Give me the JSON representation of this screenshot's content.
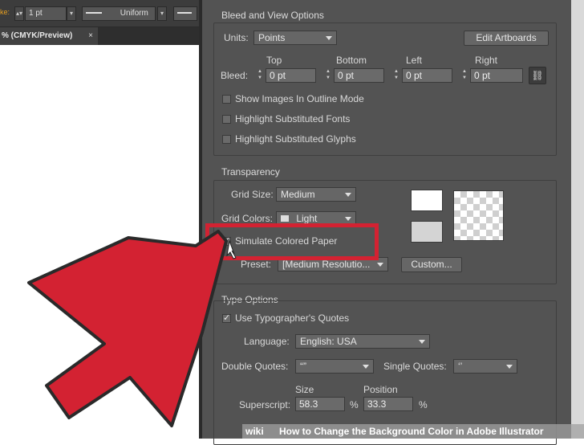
{
  "app": {
    "toolbar": {
      "left_fragment": "ke:",
      "stroke_weight": "1 pt",
      "stroke_profile": "Uniform"
    },
    "doc_tab": {
      "title": "% (CMYK/Preview)",
      "close": "×"
    }
  },
  "dialog": {
    "bleed_view": {
      "title": "Bleed and View Options",
      "units_label": "Units:",
      "units_value": "Points",
      "edit_artboards": "Edit Artboards",
      "bleed_label": "Bleed:",
      "top_label": "Top",
      "bottom_label": "Bottom",
      "left_label": "Left",
      "right_label": "Right",
      "top_value": "0 pt",
      "bottom_value": "0 pt",
      "left_value": "0 pt",
      "right_value": "0 pt",
      "show_outline": "Show Images In Outline Mode",
      "highlight_fonts": "Highlight Substituted Fonts",
      "highlight_glyphs": "Highlight Substituted Glyphs",
      "show_outline_checked": false,
      "highlight_fonts_checked": false,
      "highlight_glyphs_checked": false
    },
    "transparency": {
      "title": "Transparency",
      "grid_size_label": "Grid Size:",
      "grid_size_value": "Medium",
      "grid_colors_label": "Grid Colors:",
      "grid_colors_value": "Light",
      "simulate_paper": "Simulate Colored Paper",
      "simulate_paper_checked": true,
      "preset_label": "Preset:",
      "preset_value": "[Medium Resolutio...",
      "custom_button": "Custom..."
    },
    "type_options": {
      "title": "Type Options",
      "typographers_quotes": "Use Typographer's Quotes",
      "typographers_quotes_checked": true,
      "language_label": "Language:",
      "language_value": "English: USA",
      "double_quotes_label": "Double Quotes:",
      "double_quotes_value": "“”",
      "single_quotes_label": "Single Quotes:",
      "single_quotes_value": "‘’",
      "size_label": "Size",
      "position_label": "Position",
      "superscript_label": "Superscript:",
      "superscript_size": "58.3",
      "superscript_position": "33.3",
      "percent": "%"
    }
  },
  "watermark": {
    "logo": "wiki",
    "text": "How to Change the Background Color in Adobe Illustrator"
  },
  "colors": {
    "dialog_bg": "#535353",
    "callout_red": "#d32232"
  }
}
